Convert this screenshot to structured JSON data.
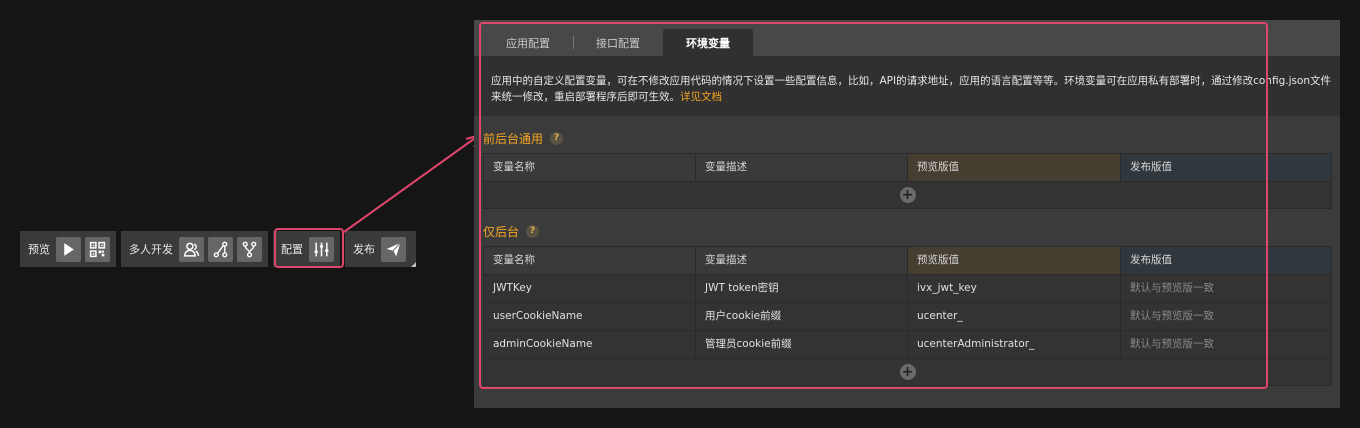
{
  "toolbar": {
    "preview_label": "预览",
    "multi_dev_label": "多人开发",
    "config_label": "配置",
    "publish_label": "发布"
  },
  "tabs": [
    "应用配置",
    "接口配置",
    "环境变量"
  ],
  "active_tab": "环境变量",
  "description": {
    "line1": "应用中的自定义配置变量，可在不修改应用代码的情况下设置一些配置信息，比如，API的请求地址，应用的语言配置等等。环境变量可在应用私有部署时，通过修改config.json文件",
    "line2": "来统一修改，重启部署程序后即可生效。",
    "link": "详见文档"
  },
  "sections": {
    "common": {
      "title": "前后台通用",
      "help": "?",
      "headers": [
        "变量名称",
        "变量描述",
        "预览版值",
        "发布版值"
      ]
    },
    "backend_only": {
      "title": "仅后台",
      "help": "?",
      "headers": [
        "变量名称",
        "变量描述",
        "预览版值",
        "发布版值"
      ],
      "rows": [
        [
          "JWTKey",
          "JWT token密钥",
          "ivx_jwt_key",
          "默认与预览版一致"
        ],
        [
          "userCookieName",
          "用户cookie前缀",
          "ucenter_",
          "默认与预览版一致"
        ],
        [
          "adminCookieName",
          "管理员cookie前缀",
          "ucenterAdministrator_",
          "默认与预览版一致"
        ]
      ]
    }
  },
  "add_symbol": "+",
  "colors": {
    "accent": "#f5a623",
    "highlight": "#e0466c"
  }
}
